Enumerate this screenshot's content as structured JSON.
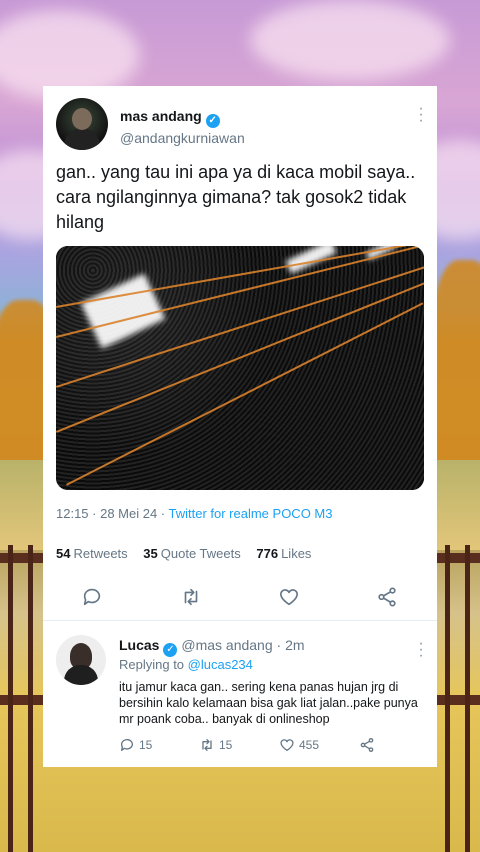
{
  "tweet": {
    "display_name": "mas andang",
    "handle": "@andangkurniawan",
    "text": "gan.. yang tau ini apa ya di kaca mobil saya.. cara ngilanginnya gimana? tak gosok2 tidak hilang",
    "time": "12:15 · 28 Mei 24 · ",
    "source": "Twitter for realme POCO M3",
    "retweets_count": "54",
    "retweets_label": "Retweets",
    "quotes_count": "35",
    "quotes_label": "Quote Tweets",
    "likes_count": "776",
    "likes_label": "Likes"
  },
  "reply": {
    "display_name": "Lucas",
    "meta": "@mas andang · 2m",
    "replying_prefix": "Replying to ",
    "replying_to": "@lucas234",
    "text": "itu jamur kaca gan.. sering kena panas hujan jrg di bersihin kalo kelamaan bisa gak liat jalan..pake punya mr poank coba.. banyak di onlineshop",
    "reply_count": "15",
    "retweet_count": "15",
    "like_count": "455"
  },
  "colors": {
    "accent": "#1da1f2",
    "text_primary": "#14171a",
    "text_secondary": "#657786"
  },
  "icons": [
    "verified-badge-icon",
    "more-options-icon",
    "reply-icon",
    "retweet-icon",
    "like-icon",
    "share-icon"
  ]
}
